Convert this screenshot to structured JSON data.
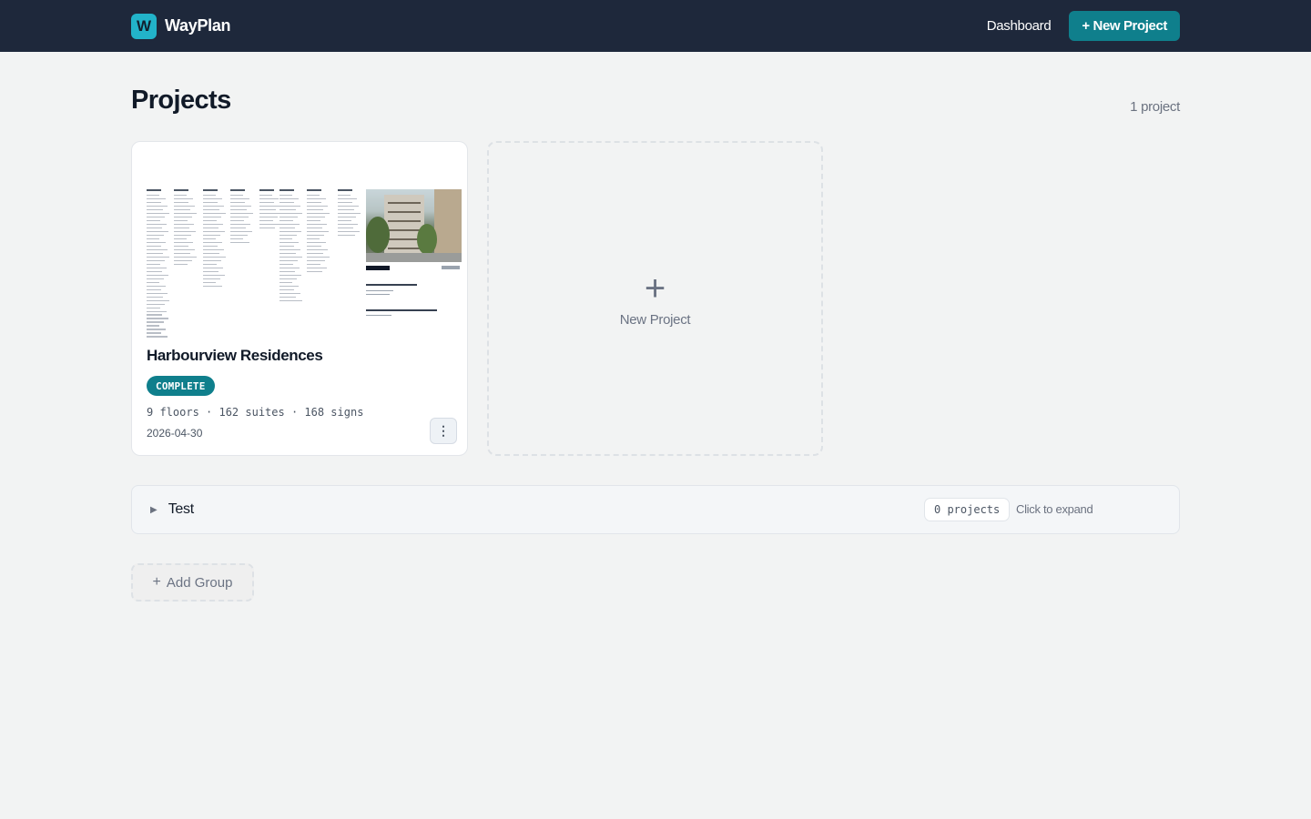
{
  "header": {
    "logo_letter": "W",
    "brand": "WayPlan",
    "nav_dashboard": "Dashboard",
    "new_project_button": "+ New Project"
  },
  "page": {
    "title": "Projects",
    "count": "1 project"
  },
  "projects": [
    {
      "name": "Harbourview Residences",
      "status": "COMPLETE",
      "meta": "9 floors · 162 suites · 168 signs",
      "date": "2026-04-30",
      "menu_glyph": "⋮"
    }
  ],
  "new_project_card": {
    "plus": "+",
    "label": "New Project"
  },
  "groups": [
    {
      "caret": "▶",
      "name": "Test",
      "count": "0 projects",
      "hint": "Click to expand"
    }
  ],
  "add_group": {
    "plus": "+",
    "label": "Add Group"
  },
  "colors": {
    "header_bg": "#1e283b",
    "accent": "#0f7f8c",
    "logo": "#22b3c9",
    "page_bg": "#f2f3f3"
  },
  "icons": {
    "logo": "wayplan-logo-icon",
    "menu": "more-vertical-icon",
    "plus": "plus-icon",
    "caret": "caret-right-icon"
  }
}
